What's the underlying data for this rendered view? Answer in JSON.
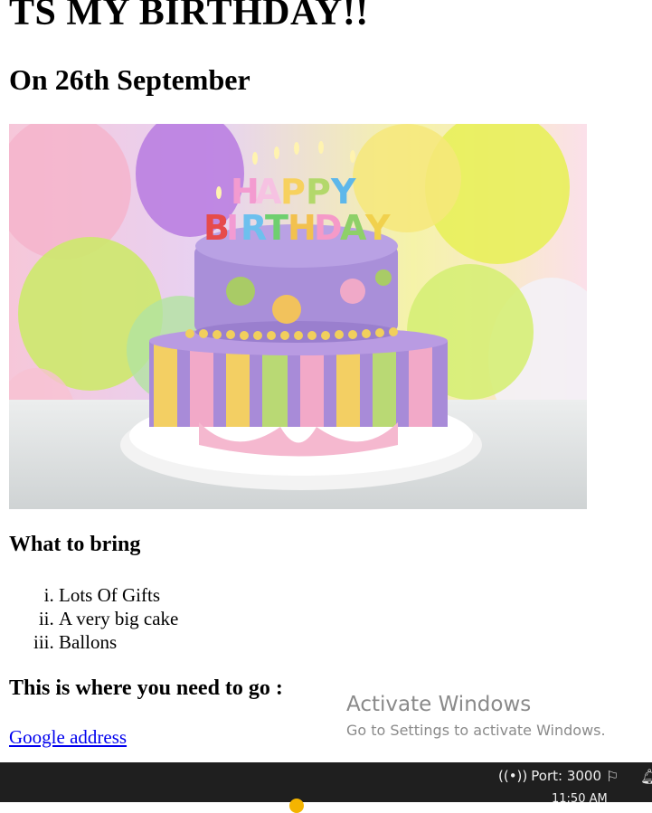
{
  "heading": "TS MY BIRTHDAY!!",
  "subheading": "On 26th September",
  "image": {
    "alt": "HAPPY BIRTHDAY",
    "icon": "birthday-cake-photo"
  },
  "bring": {
    "title": "What to bring",
    "items": [
      "Lots Of Gifts",
      "A very big cake",
      "Ballons"
    ]
  },
  "where": {
    "title": "This is where you need to go :"
  },
  "link": {
    "label": "Google address"
  },
  "watermark": {
    "title": "Activate Windows",
    "subtitle": "Go to Settings to activate Windows."
  },
  "taskbar": {
    "port_label": "Port: 3000",
    "time": "11:50 AM"
  }
}
